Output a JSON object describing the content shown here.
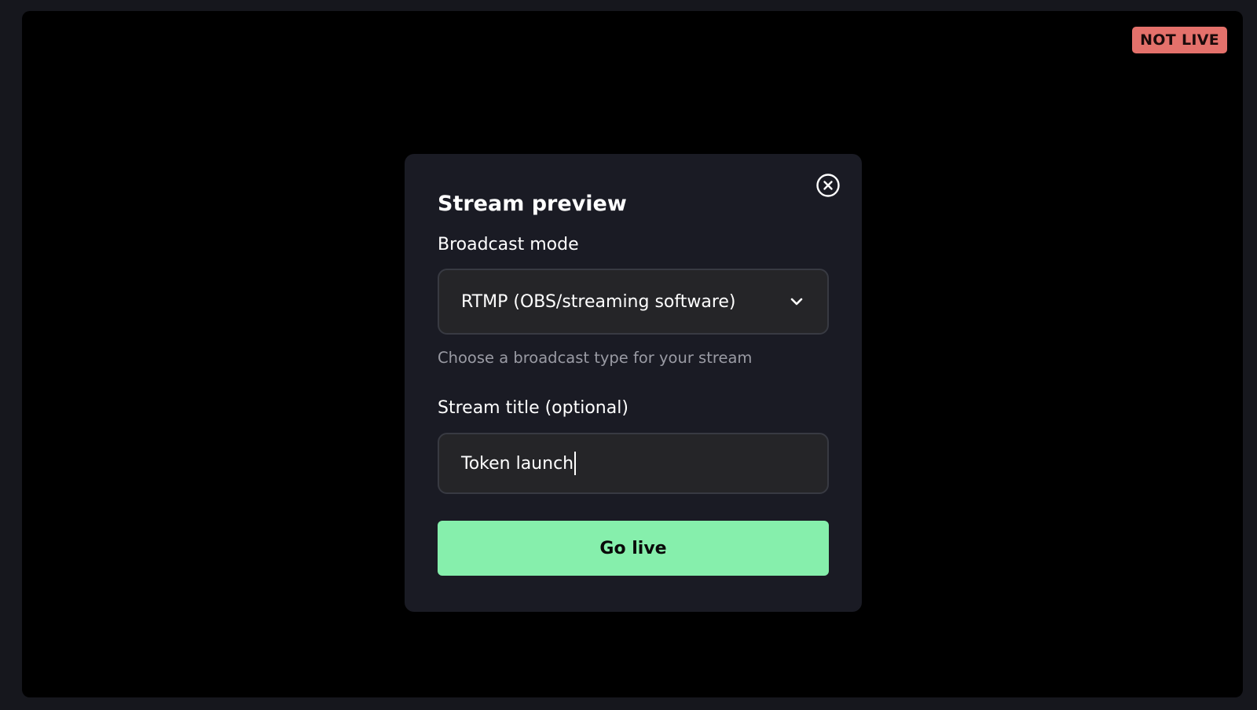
{
  "status_badge": {
    "label": "NOT LIVE",
    "color": "#e4716b"
  },
  "modal": {
    "title": "Stream preview",
    "close_icon": "close-circle-icon",
    "broadcast_mode": {
      "label": "Broadcast mode",
      "selected": "RTMP (OBS/streaming software)",
      "icon": "chevron-down-icon",
      "helper": "Choose a broadcast type for your stream"
    },
    "stream_title": {
      "label": "Stream title (optional)",
      "value": "Token launch"
    },
    "go_live": {
      "label": "Go live",
      "color": "#86efac"
    }
  }
}
